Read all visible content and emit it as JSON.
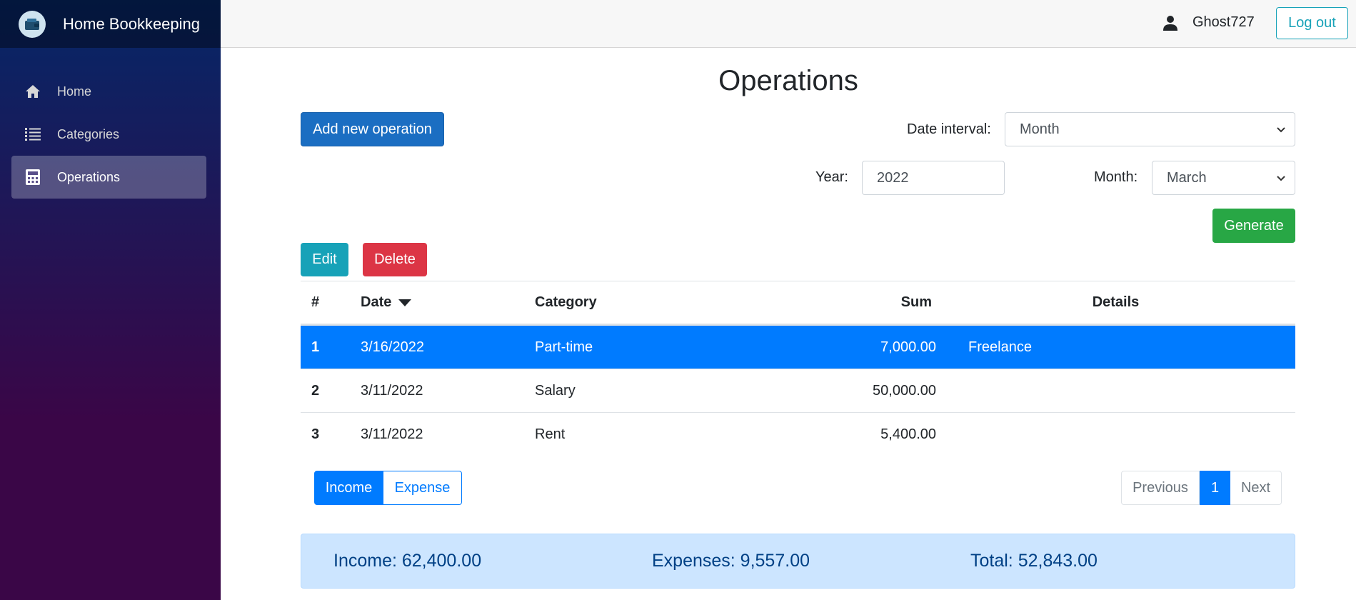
{
  "app": {
    "title": "Home Bookkeeping"
  },
  "sidebar": {
    "items": [
      {
        "label": "Home",
        "icon": "home-icon",
        "active": false
      },
      {
        "label": "Categories",
        "icon": "list-icon",
        "active": false
      },
      {
        "label": "Operations",
        "icon": "calculator-icon",
        "active": true
      }
    ]
  },
  "topbar": {
    "username": "Ghost727",
    "logout_label": "Log out"
  },
  "page": {
    "title": "Operations"
  },
  "toolbar": {
    "add_label": "Add new operation",
    "edit_label": "Edit",
    "delete_label": "Delete",
    "generate_label": "Generate"
  },
  "filters": {
    "date_interval_label": "Date interval:",
    "date_interval_value": "Month",
    "year_label": "Year:",
    "year_value": "2022",
    "month_label": "Month:",
    "month_value": "March"
  },
  "table": {
    "headers": {
      "num": "#",
      "date": "Date",
      "category": "Category",
      "sum": "Sum",
      "details": "Details"
    },
    "rows": [
      {
        "num": "1",
        "date": "3/16/2022",
        "category": "Part-time",
        "sum": "7,000.00",
        "details": "Freelance",
        "selected": true
      },
      {
        "num": "2",
        "date": "3/11/2022",
        "category": "Salary",
        "sum": "50,000.00",
        "details": "",
        "selected": false
      },
      {
        "num": "3",
        "date": "3/11/2022",
        "category": "Rent",
        "sum": "5,400.00",
        "details": "",
        "selected": false
      }
    ]
  },
  "type_toggle": {
    "income_label": "Income",
    "expense_label": "Expense",
    "selected": "Income"
  },
  "pagination": {
    "previous_label": "Previous",
    "current_page": "1",
    "next_label": "Next"
  },
  "summary": {
    "income": "Income: 62,400.00",
    "expenses": "Expenses: 9,557.00",
    "total": "Total: 52,843.00"
  },
  "colors": {
    "primary": "#007bff",
    "add_button": "#1b6ec2",
    "info": "#17a2b8",
    "danger": "#dc3545",
    "success": "#28a745",
    "summary_bg": "#cce5ff"
  }
}
